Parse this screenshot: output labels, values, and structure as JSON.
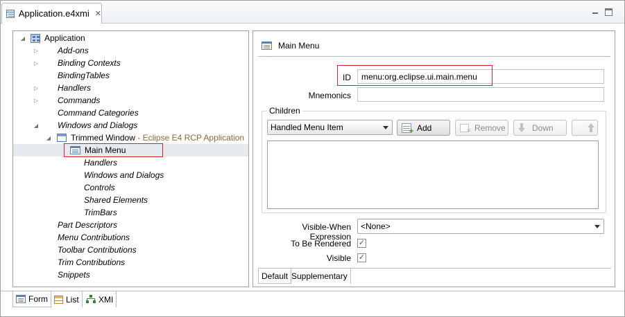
{
  "editor": {
    "tab_title": "Application.e4xmi",
    "tab_close": "✕"
  },
  "tree": {
    "root_label": "Application",
    "items": [
      {
        "label": "Add-ons",
        "italic": true
      },
      {
        "label": "Binding Contexts",
        "italic": true
      },
      {
        "label": "BindingTables",
        "italic": true
      },
      {
        "label": "Handlers",
        "italic": true
      },
      {
        "label": "Commands",
        "italic": true
      },
      {
        "label": "Command Categories",
        "italic": true
      },
      {
        "label": "Windows and Dialogs",
        "italic": true
      }
    ],
    "trimmed_window_label": "Trimmed Window",
    "trimmed_window_suffix": " - Eclipse E4 RCP Application",
    "main_menu_label": "Main Menu",
    "window_children": [
      {
        "label": "Handlers"
      },
      {
        "label": "Windows and Dialogs"
      },
      {
        "label": "Controls"
      },
      {
        "label": "Shared Elements"
      },
      {
        "label": "TrimBars"
      }
    ],
    "bottom_items": [
      {
        "label": "Part Descriptors"
      },
      {
        "label": "Menu Contributions"
      },
      {
        "label": "Toolbar Contributions"
      },
      {
        "label": "Trim Contributions"
      },
      {
        "label": "Snippets"
      }
    ]
  },
  "form": {
    "header_title": "Main Menu",
    "id_label": "ID",
    "id_value": "menu:org.eclipse.ui.main.menu",
    "mnemonics_label": "Mnemonics",
    "mnemonics_value": "",
    "children_group_label": "Children",
    "children_type_selected": "Handled Menu Item",
    "add_button": "Add",
    "remove_button": "Remove",
    "down_button": "Down",
    "visible_when_label": "Visible-When Expression",
    "visible_when_value": "<None>",
    "to_be_rendered_label": "To Be Rendered",
    "to_be_rendered_checked": true,
    "visible_label": "Visible",
    "visible_checked": true,
    "subtab_default": "Default",
    "subtab_supplementary": "Supplementary"
  },
  "bottom_tabs": {
    "form": "Form",
    "list": "List",
    "xmi": "XMI"
  },
  "colors": {
    "highlight_border": "#d0252a",
    "selection_bg": "#e6e9ee",
    "suffix_text": "#8a6a3a"
  }
}
